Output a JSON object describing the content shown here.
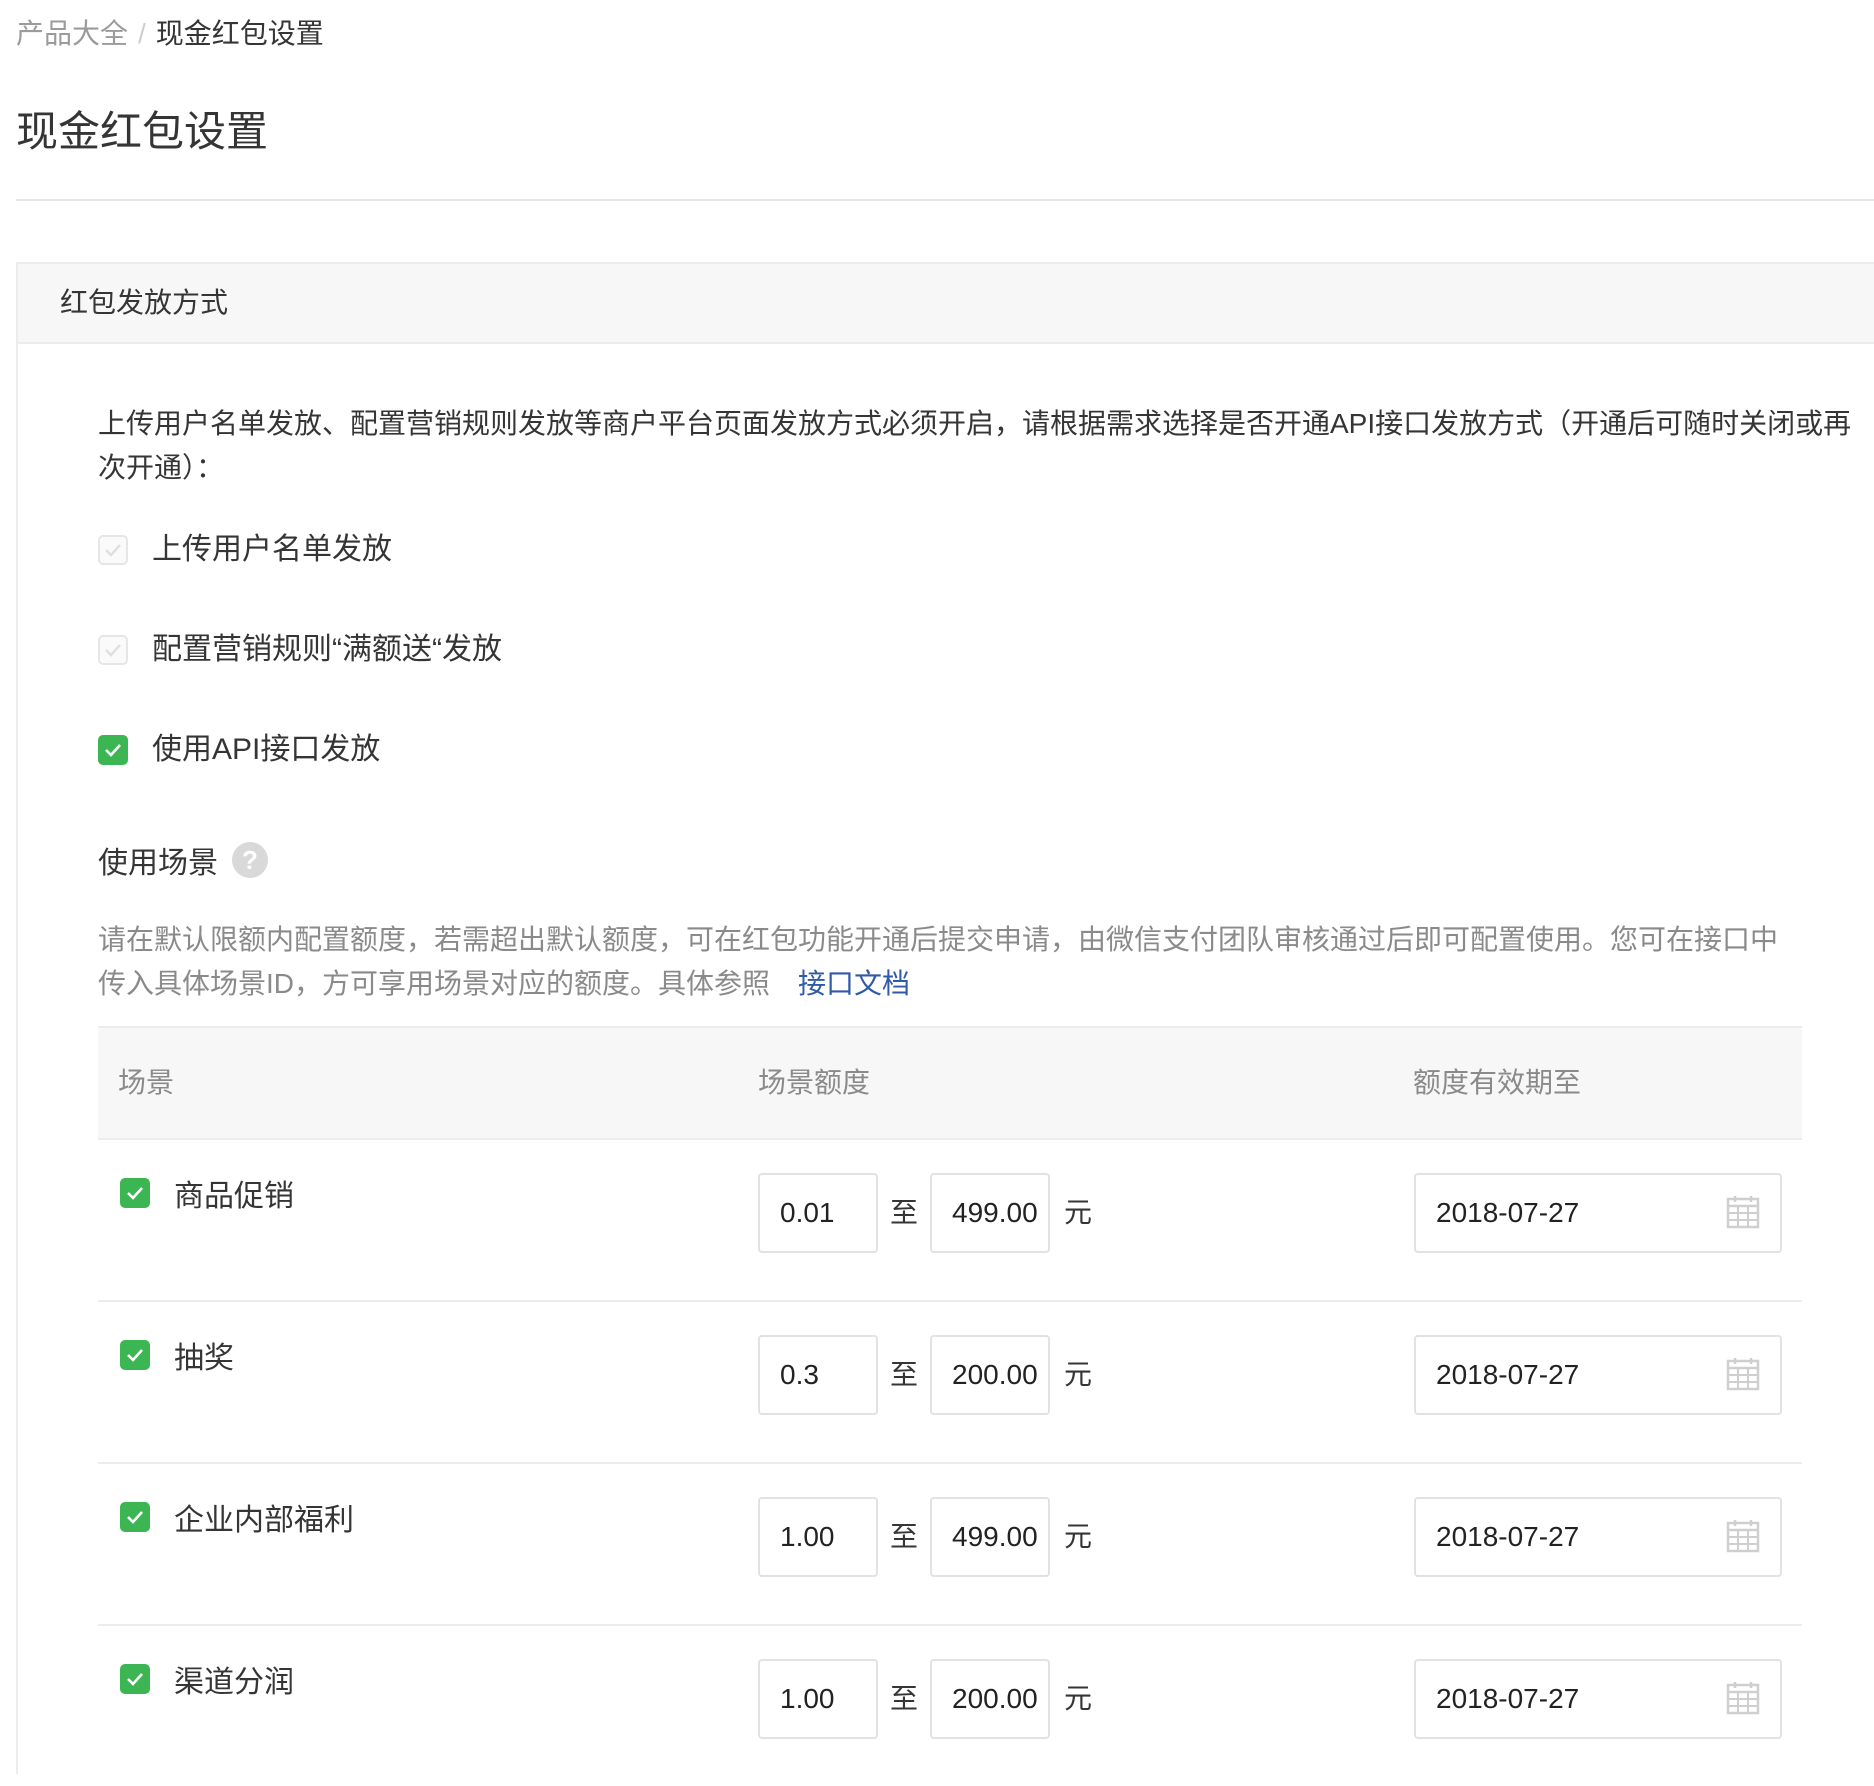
{
  "breadcrumb": {
    "parent": "产品大全",
    "separator": "/",
    "current": "现金红包设置"
  },
  "page_title": "现金红包设置",
  "panel": {
    "title": "红包发放方式",
    "intro_line1": "上传用户名单发放、配置营销规则发放等商户平台页面发放方式必须开启，请根据需求选择是否开通API接口发放方式（开通后可随时关闭或再",
    "intro_line2": "次开通）：",
    "options": [
      {
        "label": "上传用户名单发放",
        "checked": false,
        "disabled": true
      },
      {
        "label": "配置营销规则“满额送“发放",
        "checked": false,
        "disabled": true
      },
      {
        "label": "使用API接口发放",
        "checked": true,
        "disabled": false
      }
    ]
  },
  "scenes": {
    "title": "使用场景",
    "help_icon": "question-icon",
    "desc_line1": "请在默认限额内配置额度，若需超出默认额度，可在红包功能开通后提交申请，由微信支付团队审核通过后即可配置使用。您可在接口中",
    "desc_line2": "传入具体场景ID，方可享用场景对应的额度。具体参照",
    "doc_link": "接口文档",
    "columns": [
      "场景",
      "场景额度",
      "额度有效期至"
    ],
    "to_label": "至",
    "unit_label": "元",
    "rows": [
      {
        "name": "商品促销",
        "checked": true,
        "min": "0.01",
        "max": "499.00",
        "date": "2018-07-27"
      },
      {
        "name": "抽奖",
        "checked": true,
        "min": "0.3",
        "max": "200.00",
        "date": "2018-07-27"
      },
      {
        "name": "企业内部福利",
        "checked": true,
        "min": "1.00",
        "max": "499.00",
        "date": "2018-07-27"
      },
      {
        "name": "渠道分润",
        "checked": true,
        "min": "1.00",
        "max": "200.00",
        "date": "2018-07-27"
      }
    ]
  },
  "colors": {
    "accent_green": "#3cb553",
    "link_blue": "#2f5aa8",
    "muted_text": "#8a8a8a"
  }
}
